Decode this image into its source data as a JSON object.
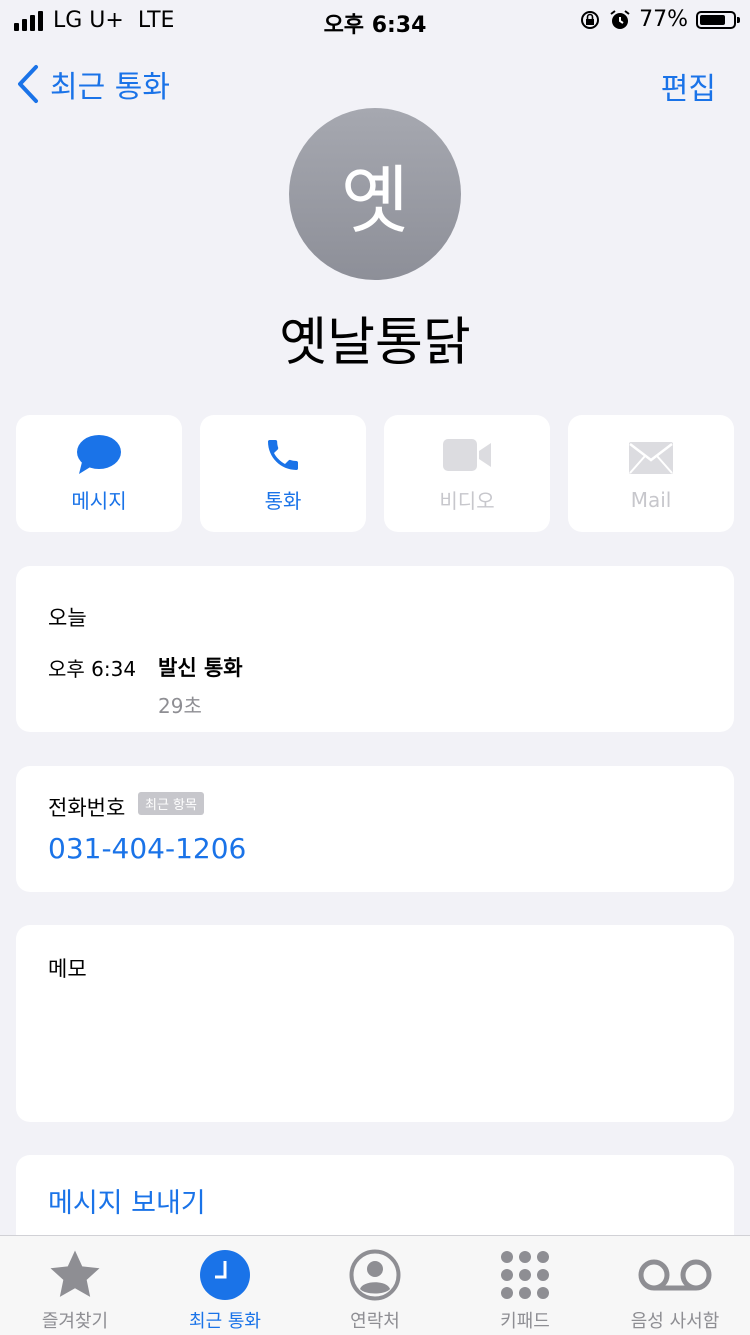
{
  "status": {
    "carrier": "LG U+",
    "network": "LTE",
    "time": "오후 6:34",
    "battery": "77%",
    "battery_level": 0.77
  },
  "nav": {
    "back_label": "최근 통화",
    "edit_label": "편집"
  },
  "contact": {
    "avatar_initial": "옛",
    "name": "옛날통닭"
  },
  "actions": [
    {
      "label": "메시지",
      "icon": "message-bubble-icon",
      "enabled": true
    },
    {
      "label": "통화",
      "icon": "phone-icon",
      "enabled": true
    },
    {
      "label": "비디오",
      "icon": "video-icon",
      "enabled": false
    },
    {
      "label": "Mail",
      "icon": "mail-icon",
      "enabled": false
    }
  ],
  "recents": {
    "day": "오늘",
    "time": "오후 6:34",
    "type": "발신 통화",
    "duration": "29초"
  },
  "phone": {
    "label": "전화번호",
    "badge": "최근 항목",
    "number": "031-404-1206"
  },
  "memo": {
    "label": "메모"
  },
  "send_message": {
    "label": "메시지 보내기"
  },
  "tabs": [
    {
      "label": "즐겨찾기",
      "icon": "star-icon",
      "active": false
    },
    {
      "label": "최근 통화",
      "icon": "clock-icon",
      "active": true
    },
    {
      "label": "연락처",
      "icon": "person-circle-icon",
      "active": false
    },
    {
      "label": "키패드",
      "icon": "keypad-icon",
      "active": false
    },
    {
      "label": "음성 사서함",
      "icon": "voicemail-icon",
      "active": false
    }
  ],
  "colors": {
    "accent": "#1a73e8",
    "background": "#f2f2f7",
    "disabled": "#c7c7cc"
  }
}
